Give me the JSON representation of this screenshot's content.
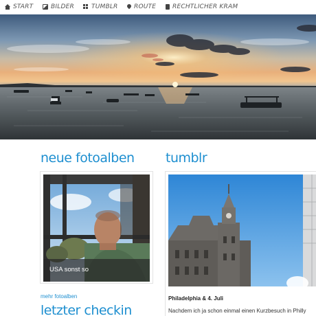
{
  "nav": {
    "items": [
      {
        "label": "START",
        "icon": "home-icon"
      },
      {
        "label": "BILDER",
        "icon": "image-icon"
      },
      {
        "label": "TUMBLR",
        "icon": "tumblr-icon"
      },
      {
        "label": "ROUTE",
        "icon": "pin-icon"
      },
      {
        "label": "RECHTLICHER KRAM",
        "icon": "book-icon"
      }
    ]
  },
  "sections": {
    "albums_title": "neue fotoalben",
    "tumblr_title": "tumblr",
    "checkin_title": "letzter checkin"
  },
  "album": {
    "caption": "USA sonst so",
    "more_link": "mehr fotoalben"
  },
  "tumblr_post": {
    "title": "Philadelphia & 4. Juli",
    "excerpt": "Nachdem ich ja schon einmal einen Kurzbesuch in Philly"
  },
  "colors": {
    "accent": "#1e8fd0"
  }
}
